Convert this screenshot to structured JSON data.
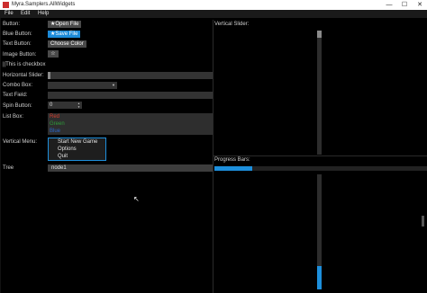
{
  "window": {
    "title": "Myra.Samplers.AllWidgets",
    "controls": {
      "minimize": "—",
      "maximize": "☐",
      "close": "✕"
    }
  },
  "menu": [
    "File",
    "Edit",
    "Help"
  ],
  "left": {
    "button_label": "Button:",
    "open_file": "Open File",
    "blue_button_label": "Blue Button:",
    "save_file": "Save File",
    "text_button_label": "Text Button:",
    "choose_color": "Choose Color",
    "image_button_label": "Image Button:",
    "checkbox_text": "This is checkbox",
    "horizontal_slider_label": "Horizontal Slider:",
    "combo_box_label": "Combo Box:",
    "text_field_label": "Text Field:",
    "spin_button_label": "Spin Button:",
    "spin_value": "0",
    "list_box_label": "List Box:",
    "list_items": [
      {
        "text": "Red",
        "color": "#d23b2b"
      },
      {
        "text": "Green",
        "color": "#2e9c3a"
      },
      {
        "text": "Blue",
        "color": "#2a66c9"
      }
    ],
    "vertical_menu_label": "Vertical Menu:",
    "vertical_menu_items": [
      "Start New Game",
      "Options",
      "Quit"
    ],
    "tree_label": "Tree",
    "tree_node": "node1"
  },
  "right": {
    "vertical_slider_label": "Vertical Slider:",
    "progress_bars_label": "Progress Bars:",
    "horizontal_progress": 0.2,
    "vertical_progress": 0.2
  },
  "colors": {
    "accent": "#1d8fdc",
    "panel": "#333333"
  }
}
